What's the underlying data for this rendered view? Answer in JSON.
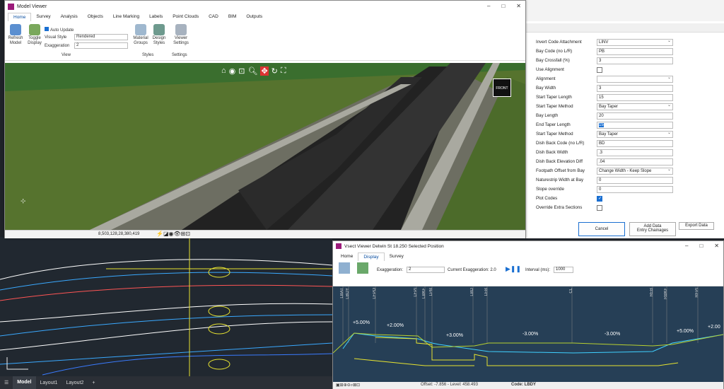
{
  "model_viewer": {
    "title": "Model Viewer",
    "tabs": [
      "Home",
      "Survey",
      "Analysis",
      "Objects",
      "Line Marking",
      "Labels",
      "Point Clouds",
      "CAD",
      "BIM",
      "Outputs"
    ],
    "ribbon": {
      "refresh": "Refresh\nModel",
      "toggle": "Toggle\nDisplay",
      "auto_update": "Auto Update",
      "visual_style_label": "Visual Style",
      "visual_style_value": "Rendered",
      "exaggeration_label": "Exaggeration",
      "exaggeration_value": "2",
      "group_view": "View",
      "material": "Material\nGroups",
      "design": "Design\nStyles",
      "group_styles": "Styles",
      "viewer_settings": "Viewer\nSettings",
      "group_settings": "Settings"
    },
    "cube_label": "FRONT",
    "status_coords": "8,503,128,28,380,419"
  },
  "properties": {
    "rows": [
      {
        "label": "Invert Code Attachment",
        "value": "LINV",
        "type": "dd"
      },
      {
        "label": "Bay Code (no L/R)",
        "value": "PB",
        "type": "text"
      },
      {
        "label": "Bay Crossfall (%)",
        "value": "3",
        "type": "text"
      },
      {
        "label": "Use Alignment",
        "value": "",
        "type": "chk"
      },
      {
        "label": "Alignment",
        "value": "",
        "type": "dd"
      },
      {
        "label": "Bay Width",
        "value": "3",
        "type": "text"
      },
      {
        "label": "Start Taper Length",
        "value": "15",
        "type": "text"
      },
      {
        "label": "Start Taper Method",
        "value": "Bay Taper",
        "type": "dd"
      },
      {
        "label": "Bay Length",
        "value": "20",
        "type": "text"
      },
      {
        "label": "End Taper Length",
        "value": "15",
        "type": "sel"
      },
      {
        "label": "Start Taper Method",
        "value": "Bay Taper",
        "type": "dd"
      },
      {
        "label": "Dish Back Code (no L/R)",
        "value": "BD",
        "type": "text"
      },
      {
        "label": "Dish Back Width",
        "value": ".3",
        "type": "text"
      },
      {
        "label": "Dish Back Elevation Diff",
        "value": ".04",
        "type": "text"
      },
      {
        "label": "Footpath Offset from Bay",
        "value": "Change Width - Keep Slope",
        "type": "dd"
      },
      {
        "label": "Naturestrip Width at Bay",
        "value": "0",
        "type": "text"
      },
      {
        "label": "Slope override",
        "value": "0",
        "type": "text"
      },
      {
        "label": "Plot Codes",
        "value": "",
        "type": "chkon"
      },
      {
        "label": "Override Extra Sections",
        "value": "",
        "type": "chk"
      }
    ],
    "cancel": "Cancel",
    "add_data": "Add Data\nEntry Chainages",
    "export": "Export Data"
  },
  "vsect": {
    "title": "Vsect Viewer Delwin St  18.250 Selected Position",
    "tabs": [
      "Home",
      "Display",
      "Survey"
    ],
    "exaggeration_label": "Exaggeration:",
    "exaggeration_value": "2",
    "current_exag": "Current Exaggeration: 2.0",
    "interval_label": "Interval (ms):",
    "interval_value": "1000",
    "codes": [
      "LBAT",
      "LBDY",
      "LFPO",
      "LFPI",
      "LBKF",
      "LPB",
      "LBD",
      "LEB",
      "CL",
      "REB",
      "RBKF",
      "RFPI"
    ],
    "grades": [
      "+5.00%",
      "+2.00%",
      "+3.00%",
      "-3.00%",
      "-3.00%",
      "+5.00%",
      "+2.00"
    ],
    "status_offset": "Offset: -7.856 - Level: 458.493",
    "status_code": "Code: LBDY"
  },
  "cad": {
    "tabs": [
      "Model",
      "Layout1",
      "Layout2"
    ]
  }
}
